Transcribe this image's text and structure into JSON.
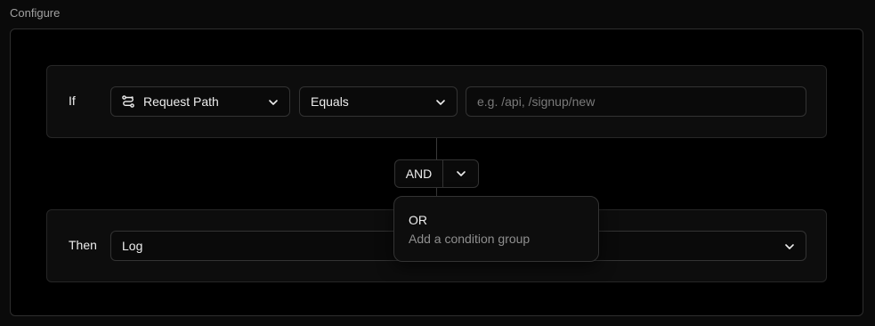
{
  "section": {
    "label": "Configure"
  },
  "condition": {
    "label": "If",
    "field": {
      "value": "Request Path",
      "icon": "route-icon"
    },
    "operator": {
      "value": "Equals"
    },
    "input": {
      "value": "",
      "placeholder": "e.g. /api, /signup/new"
    }
  },
  "logic": {
    "selected": "AND"
  },
  "dropdown": {
    "items": [
      {
        "title": "OR",
        "description": "Add a condition group"
      }
    ]
  },
  "action": {
    "label": "Then",
    "value": "Log"
  },
  "colors": {
    "background": "#0a0a0a",
    "panel": "#000000",
    "border": "#333333",
    "text": "#ededed",
    "muted": "#8f8f8f"
  }
}
